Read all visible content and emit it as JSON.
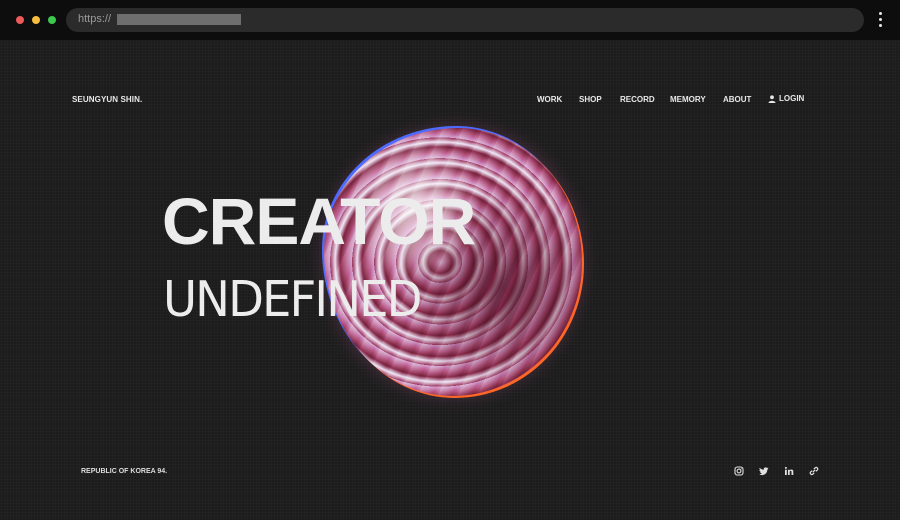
{
  "browser": {
    "url_scheme": "https://",
    "url_redacted": true
  },
  "header": {
    "brand": "SEUNGYUN SHIN.",
    "nav": [
      "WORK",
      "SHOP",
      "RECORD",
      "MEMORY",
      "ABOUT"
    ],
    "login_label": "LOGIN",
    "login_icon": "user-icon"
  },
  "hero": {
    "title_line1": "CREATOR",
    "title_line2": "UNDEFINED"
  },
  "footer": {
    "location": "REPUBLIC OF KOREA 94.",
    "social_icons": [
      "instagram-icon",
      "twitter-icon",
      "linkedin-icon",
      "link-icon"
    ]
  },
  "colors": {
    "background": "#1c1c1c",
    "text": "#e8e8e8",
    "sphere_primary": "#a35b7a"
  }
}
